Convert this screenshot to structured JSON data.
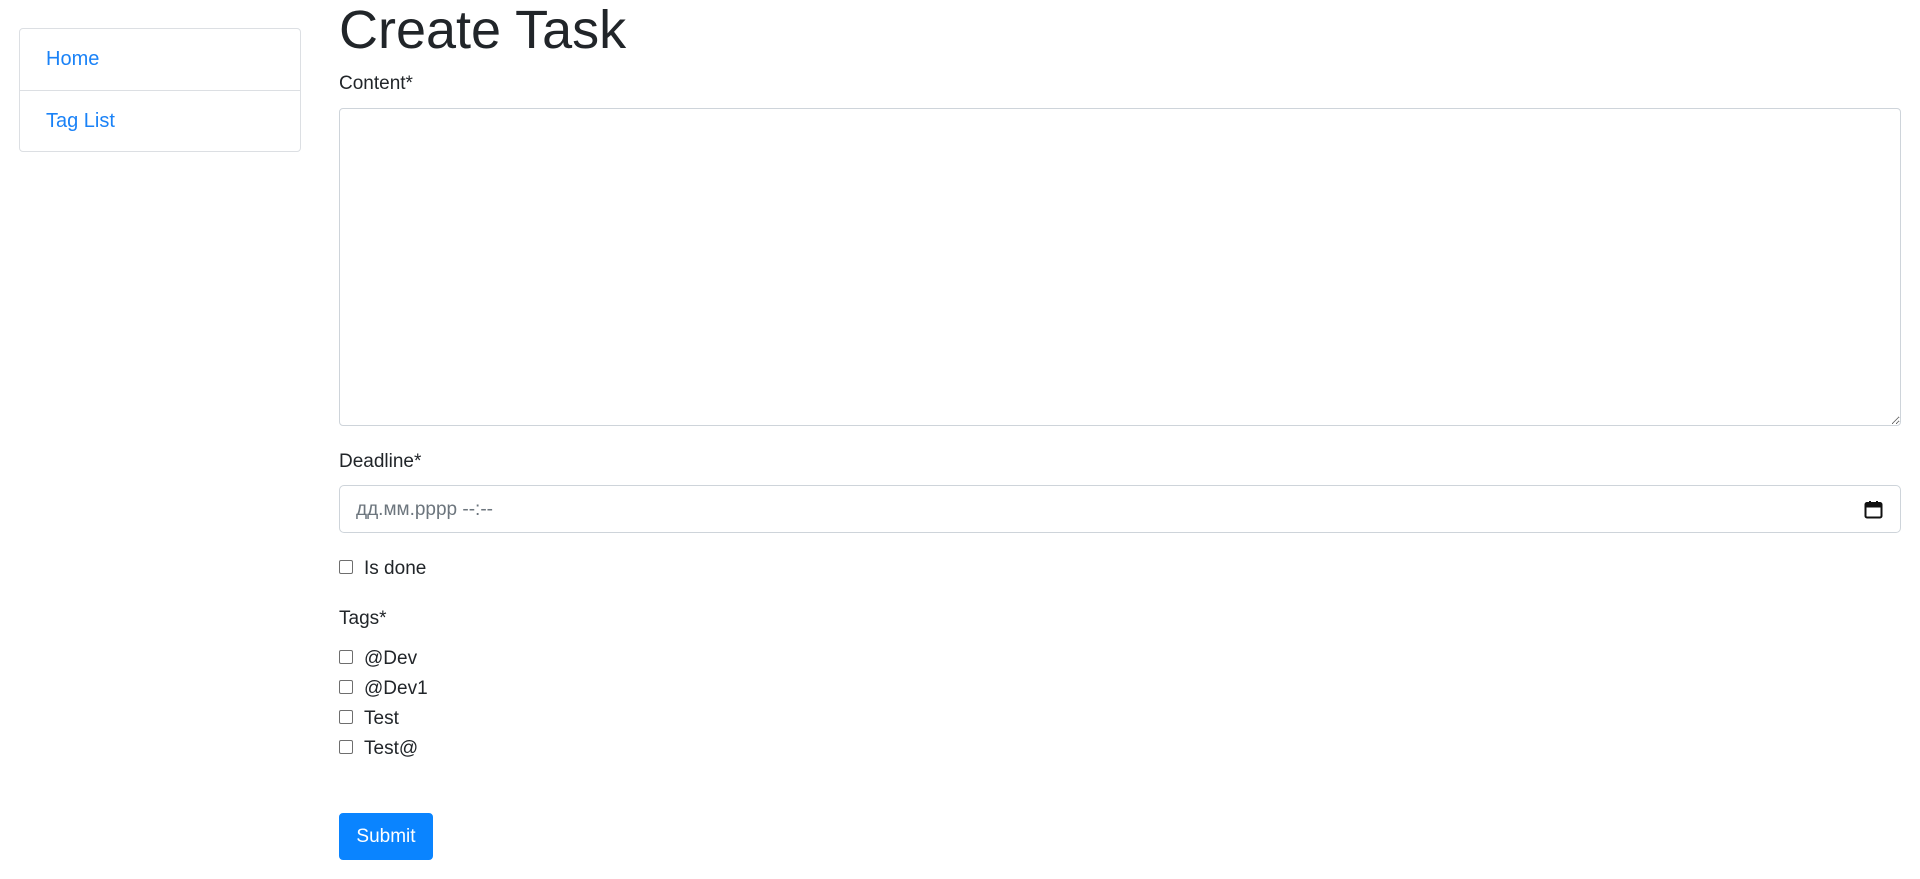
{
  "sidebar": {
    "items": [
      {
        "label": "Home"
      },
      {
        "label": "Tag List"
      }
    ]
  },
  "form": {
    "title": "Create Task",
    "content_label": "Content*",
    "content_value": "",
    "deadline_label": "Deadline*",
    "deadline_placeholder": "дд.мм.рррр --:--",
    "calendar_icon": "calendar-icon",
    "is_done_label": "Is done",
    "is_done_checked": false,
    "tags_label": "Tags*",
    "tags": [
      {
        "label": "@Dev",
        "checked": false
      },
      {
        "label": "@Dev1",
        "checked": false
      },
      {
        "label": "Test",
        "checked": false
      },
      {
        "label": "Test@",
        "checked": false
      }
    ],
    "submit_label": "Submit"
  },
  "colors": {
    "link": "#1a82f7",
    "primary_button": "#0a84ff",
    "border": "#ced4da",
    "text": "#212529"
  }
}
